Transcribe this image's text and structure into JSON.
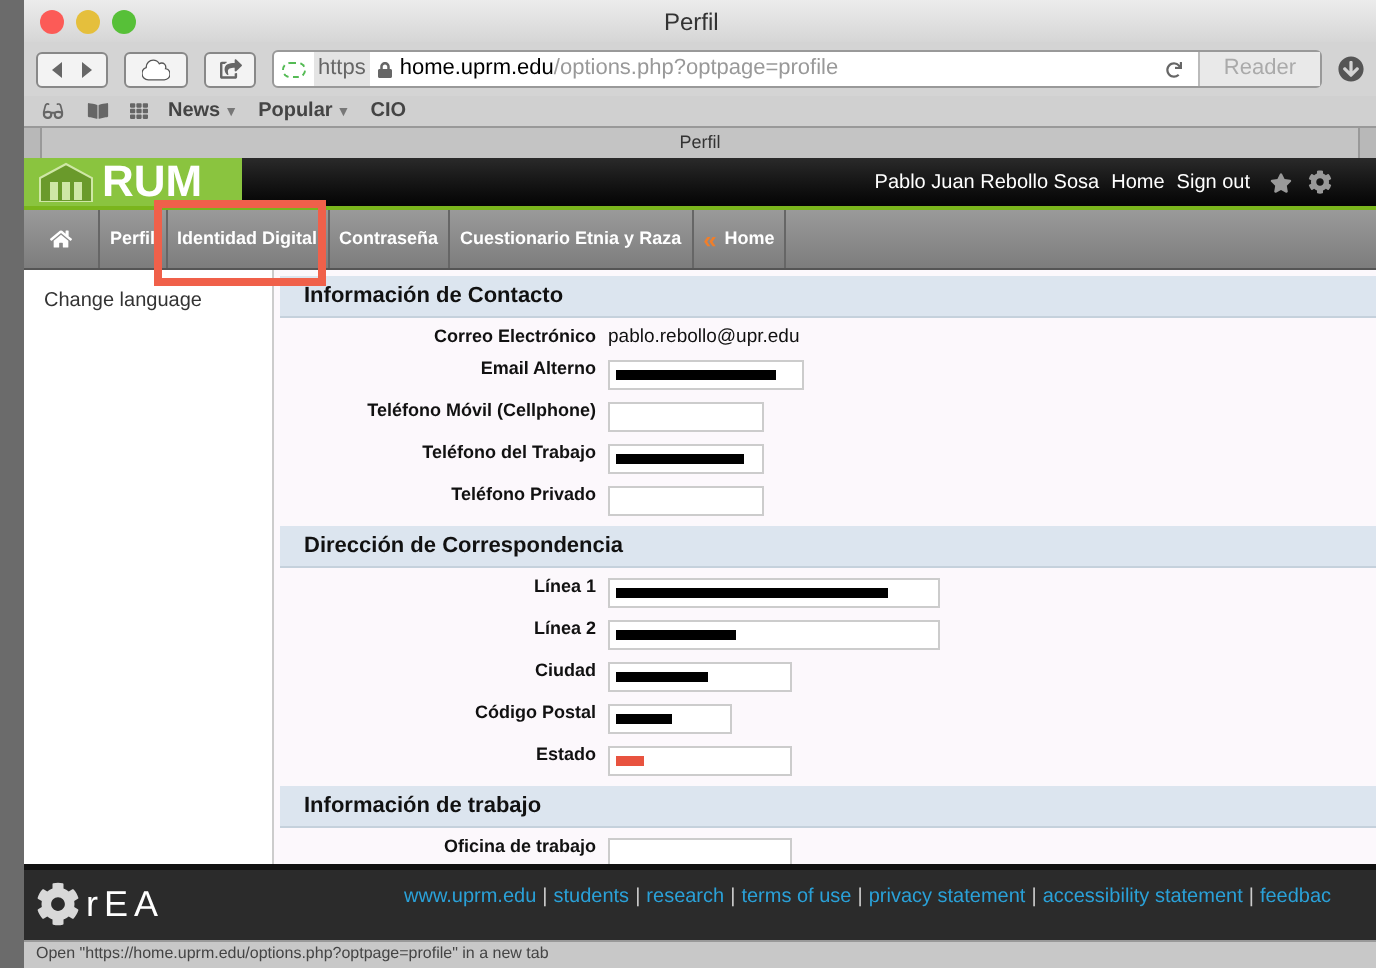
{
  "window": {
    "title": "Perfil"
  },
  "toolbar": {
    "url_scheme": "https",
    "url_host": "home.uprm.edu",
    "url_path": "/options.php?optpage=profile",
    "reader": "Reader"
  },
  "bookmarks": [
    {
      "label": "News",
      "arrow": "▼"
    },
    {
      "label": "Popular",
      "arrow": "▼"
    },
    {
      "label": "CIO"
    }
  ],
  "tab": {
    "title": "Perfil"
  },
  "header": {
    "logo": "RUM",
    "user": "Pablo Juan Rebollo Sosa",
    "links": [
      "Home",
      "Sign out"
    ]
  },
  "nav": [
    {
      "label": "Perfil"
    },
    {
      "label": "Identidad Digital"
    },
    {
      "label": "Contraseña"
    },
    {
      "label": "Cuestionario Etnia y Raza"
    },
    {
      "label": "Home",
      "prefix": "«"
    }
  ],
  "sidebar": {
    "items": [
      "Change language"
    ]
  },
  "sections": [
    {
      "title": "Información de Contacto",
      "fields": [
        {
          "label": "Correo Electrónico",
          "kind": "text",
          "value": "pablo.rebollo@upr.edu"
        },
        {
          "label": "Email Alterno",
          "kind": "input",
          "redacted": true,
          "color": "#000000"
        },
        {
          "label": "Teléfono Móvil (Cellphone)",
          "kind": "input"
        },
        {
          "label": "Teléfono del Trabajo",
          "kind": "input",
          "redacted": true,
          "color": "#000000"
        },
        {
          "label": "Teléfono Privado",
          "kind": "input"
        }
      ]
    },
    {
      "title": "Dirección de Correspondencia",
      "fields": [
        {
          "label": "Línea 1",
          "kind": "input",
          "redacted": true,
          "color": "#000000"
        },
        {
          "label": "Línea 2",
          "kind": "input",
          "redacted": true,
          "color": "#000000"
        },
        {
          "label": "Ciudad",
          "kind": "input",
          "redacted": true,
          "color": "#000000"
        },
        {
          "label": "Código Postal",
          "kind": "input",
          "redacted": true,
          "color": "#000000"
        },
        {
          "label": "Estado",
          "kind": "input",
          "redacted": true,
          "color": "#e8533f"
        }
      ]
    },
    {
      "title": "Información de trabajo",
      "fields": [
        {
          "label": "Oficina de trabajo",
          "kind": "input"
        }
      ]
    }
  ],
  "footer": {
    "logo": "rEA",
    "separator": "|",
    "links": [
      "www.uprm.edu",
      "students",
      "research",
      "terms of use",
      "privacy statement",
      "accessibility statement",
      "feedbac"
    ]
  },
  "status_bar": "Open \"https://home.uprm.edu/options.php?optpage=profile\" in a new tab"
}
